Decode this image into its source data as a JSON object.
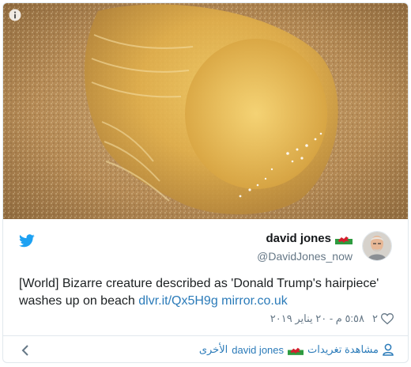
{
  "card": {
    "info_icon": "info-icon",
    "twitter_icon": "twitter-bird-icon",
    "author": {
      "name": "david jones",
      "handle": "@DavidJones_now",
      "flag_icon": "wales-flag-icon"
    },
    "tweet": {
      "text": "[World] Bizarre creature described as 'Donald Trump's hairpiece' washes up on beach",
      "link1": "dlvr.it/Qx5H9g",
      "link2": "mirror.co.uk"
    },
    "timestamp": "٥:٥٨ م - ٢٠ يناير ٢٠١٩",
    "likes": "٢",
    "footer": {
      "see_more_prefix": "مشاهدة تغريدات",
      "see_more_name": "david jones",
      "see_more_suffix": "الأخرى"
    }
  },
  "colors": {
    "brand": "#1da1f2",
    "link": "#2b7bb9",
    "muted": "#657786"
  }
}
